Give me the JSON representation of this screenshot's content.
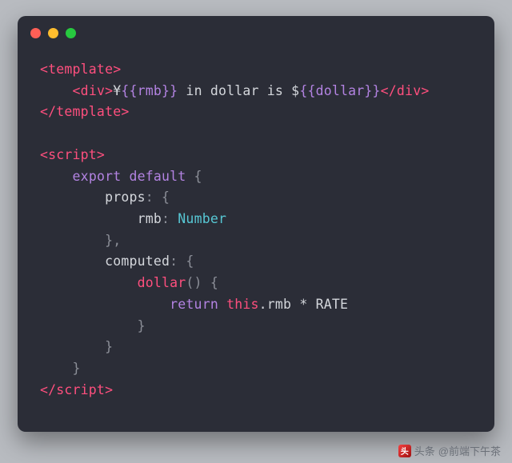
{
  "code": {
    "l1": {
      "open": "<template>"
    },
    "l2": {
      "ind": "    ",
      "open": "<div>",
      "t1": "¥",
      "e1": "{{rmb}}",
      "t2": " in dollar is $",
      "e2": "{{dollar}}",
      "close": "</div>"
    },
    "l3": {
      "close": "</template>"
    },
    "l4": {
      "blank": ""
    },
    "l5": {
      "open": "<script>"
    },
    "l6": {
      "ind": "    ",
      "kw": "export default",
      "p": " {"
    },
    "l7": {
      "ind": "        ",
      "a": "props",
      "p": ": {"
    },
    "l8": {
      "ind": "            ",
      "a": "rmb",
      "c": ": ",
      "t": "Number"
    },
    "l9": {
      "ind": "        ",
      "p": "},"
    },
    "l10": {
      "ind": "        ",
      "a": "computed",
      "p": ": {"
    },
    "l11": {
      "ind": "            ",
      "fn": "dollar",
      "p": "() {"
    },
    "l12": {
      "ind": "                ",
      "ret": "return",
      "sp": " ",
      "this": "this",
      "rest": ".rmb * RATE"
    },
    "l13": {
      "ind": "            ",
      "p": "}"
    },
    "l14": {
      "ind": "        ",
      "p": "}"
    },
    "l15": {
      "ind": "    ",
      "p": "}"
    },
    "l16": {
      "close": "</script>"
    }
  },
  "attribution": {
    "source": "头条",
    "handle": "@前端下午茶"
  }
}
